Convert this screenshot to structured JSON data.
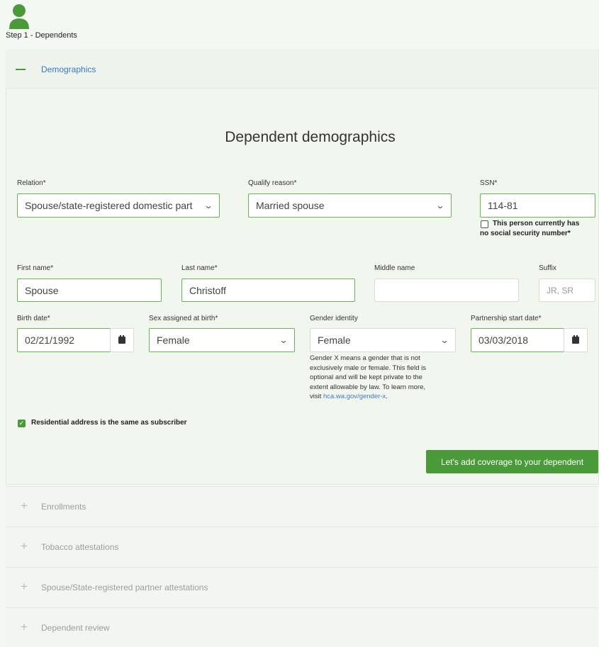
{
  "step": {
    "label": "Step 1 - Dependents",
    "icon": "person-icon"
  },
  "accordion": {
    "active_title": "Demographics"
  },
  "form": {
    "heading": "Dependent demographics",
    "relation": {
      "label": "Relation*",
      "value": "Spouse/state-registered domestic part"
    },
    "qualify_reason": {
      "label": "Qualify reason*",
      "value": "Married spouse"
    },
    "ssn": {
      "label": "SSN*",
      "value": "114-81",
      "no_ssn_label_1": "This person currently has",
      "no_ssn_label_2": "no social security number*"
    },
    "first_name": {
      "label": "First name*",
      "value": "Spouse"
    },
    "last_name": {
      "label": "Last name*",
      "value": "Christoff"
    },
    "middle_name": {
      "label": "Middle name",
      "value": ""
    },
    "suffix": {
      "label": "Suffix",
      "placeholder": "JR, SR"
    },
    "birth_date": {
      "label": "Birth date*",
      "value": "02/21/1992"
    },
    "sex_at_birth": {
      "label": "Sex assigned at birth*",
      "value": "Female"
    },
    "gender_identity": {
      "label": "Gender identity",
      "value": "Female",
      "help_lines": [
        "Gender X means a gender that is not",
        "exclusively male or female. This field is",
        "optional and will be kept private to the",
        "extent allowable by law. To learn more,"
      ],
      "help_visit": "visit ",
      "help_link": "hca.wa.gov/gender-x",
      "help_end": "."
    },
    "partnership_start": {
      "label": "Partnership start date*",
      "value": "03/03/2018"
    },
    "residential_same": {
      "label": "Residential address is the same as subscriber",
      "checked": true
    },
    "submit_label": "Let's add coverage to your dependent"
  },
  "sections": [
    {
      "title": "Enrollments"
    },
    {
      "title": "Tobacco attestations"
    },
    {
      "title": "Spouse/State-registered partner attestations"
    },
    {
      "title": "Dependent review"
    }
  ],
  "colors": {
    "accent": "#4a9a3a",
    "link": "#3c78c8"
  }
}
